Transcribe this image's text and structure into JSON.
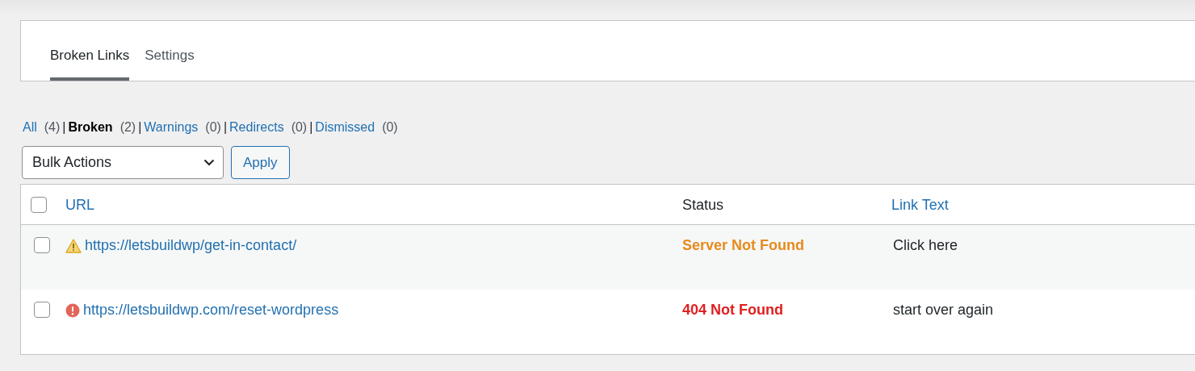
{
  "tabs": [
    {
      "label": "Broken Links",
      "selected": true
    },
    {
      "label": "Settings",
      "selected": false
    }
  ],
  "filters": [
    {
      "label": "All",
      "count": "(4)",
      "selected": false
    },
    {
      "label": "Broken",
      "count": "(2)",
      "selected": true
    },
    {
      "label": "Warnings",
      "count": "(0)",
      "selected": false
    },
    {
      "label": "Redirects",
      "count": "(0)",
      "selected": false
    },
    {
      "label": "Dismissed",
      "count": "(0)",
      "selected": false
    }
  ],
  "separator": "|",
  "bulk_actions": {
    "value": "Bulk Actions",
    "button": "Apply"
  },
  "table": {
    "select_all_checked": false,
    "columns": [
      {
        "label": "URL",
        "sortable": true
      },
      {
        "label": "Status",
        "sortable": false
      },
      {
        "label": "Link Text",
        "sortable": true
      }
    ],
    "rows": [
      {
        "kind": "warning",
        "checked": false,
        "url": "https://letsbuildwp/get-in-contact/",
        "status": "Server Not Found",
        "link_text": "Click here"
      },
      {
        "kind": "error",
        "checked": false,
        "url": "https://letsbuildwp.com/reset-wordpress",
        "status": "404 Not Found",
        "link_text": "start over again"
      }
    ]
  }
}
